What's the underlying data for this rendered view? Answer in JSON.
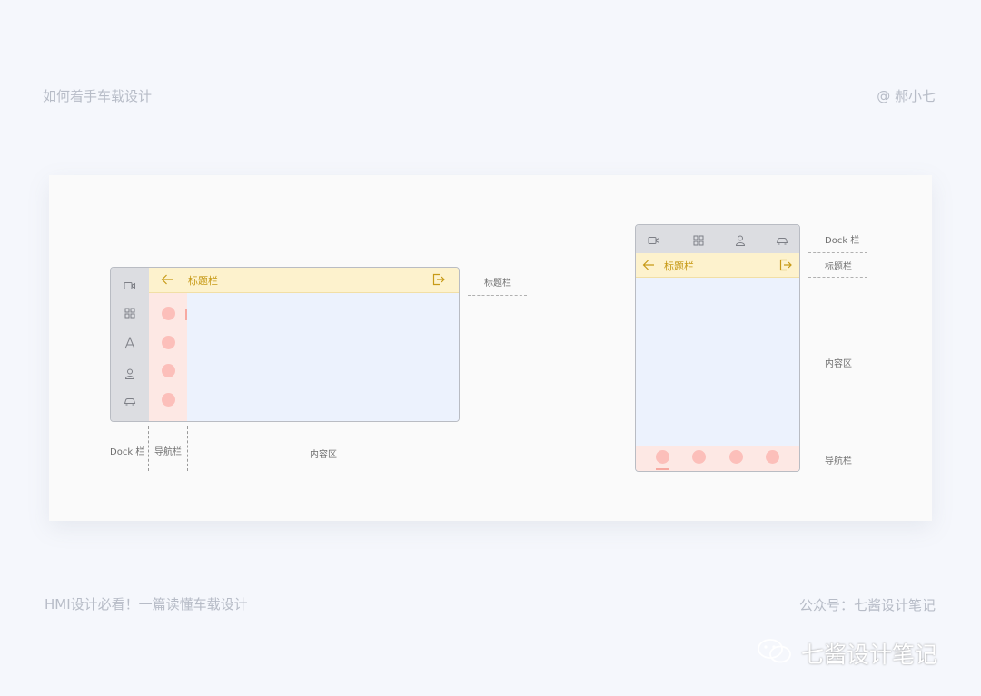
{
  "header": {
    "left_title": "如何着手车载设计",
    "author": "@ 郝小七"
  },
  "landscape": {
    "title_text": "标题栏",
    "title_label": "标题栏",
    "dock_label": "Dock 栏",
    "nav_label": "导航栏",
    "content_label": "内容区"
  },
  "portrait": {
    "title_text": "标题栏",
    "dock_label": "Dock 栏",
    "title_label": "标题栏",
    "content_label": "内容区",
    "nav_label": "导航栏"
  },
  "footer": {
    "left": "HMI设计必看！一篇读懂车载设计",
    "right": "公众号：七酱设计笔记"
  },
  "watermark": {
    "text": "七酱设计笔记"
  },
  "colors": {
    "background": "#f5f7fc",
    "dock": "#dcdde1",
    "title_bar": "#fdf2cd",
    "title_accent": "#c79a17",
    "nav_bar": "#fde8e4",
    "nav_dot": "#fcbfba",
    "content": "#ecf2fd"
  }
}
